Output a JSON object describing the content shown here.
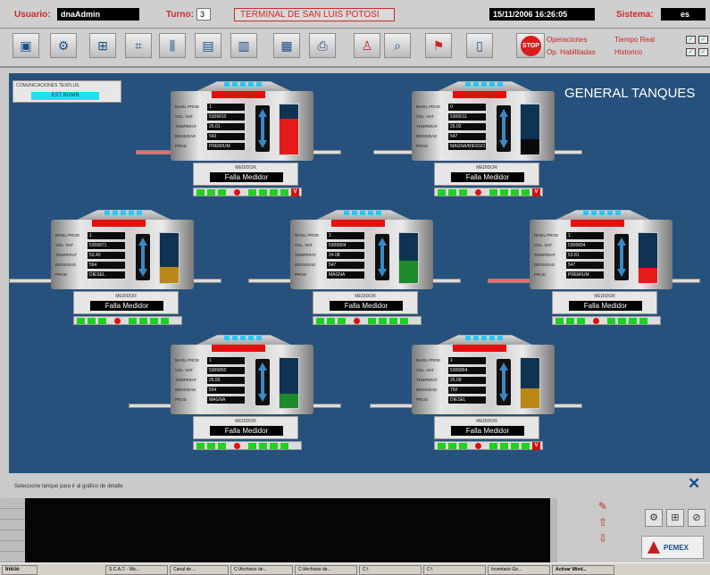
{
  "header": {
    "usuario_label": "Usuario:",
    "usuario_value": "dnaAdmin",
    "turno_label": "Turno:",
    "turno_value": "3",
    "terminal": "TERMINAL DE  SAN LUIS POTOSI",
    "datetime": "15/11/2006  16:26:05",
    "sistema_label": "Sistema:",
    "sistema_value": "es"
  },
  "toolbar": {
    "buttons": [
      "tv-icon",
      "pump-icon",
      "valve-icon",
      "chart-icon",
      "tank-icon",
      "screen-icon",
      "monitor-icon",
      "folder-icon",
      "printer-icon",
      "person-icon",
      "search-icon",
      "antenna-icon",
      "document-icon"
    ],
    "stop_label": "STOP",
    "operaciones": "Operaciones",
    "op_habilitadas": "Op. Habilitadas",
    "tiempo_real": "Tiempo Real",
    "historico": "Historico"
  },
  "main": {
    "comm_title": "COMUNICACIONES TEXPLUS",
    "comm_value": "EST BOMB",
    "title": "GENERAL TANQUES",
    "row_labels": [
      "NIVEL PROD",
      "VOL. NAT",
      "TEMPERAT",
      "DENSIDAD",
      "PROD"
    ],
    "medidor_title": "MEDIDOR",
    "tanks": [
      {
        "values": [
          "1",
          "5306810",
          "25.01",
          "543",
          "PREMIUM"
        ],
        "medidor": "Falla Medidor",
        "level": 0.72,
        "fill_color": "#e41b1b",
        "v_flag": true
      },
      {
        "values": [
          "0",
          "5306011",
          "25.02",
          "547",
          "MAGNA/RIESGO"
        ],
        "medidor": "Falla Medidor",
        "level": 0.3,
        "fill_color": "#0a0a0a",
        "v_flag": true
      },
      {
        "values": [
          "1",
          "5306871",
          "53.40",
          "564",
          "DIESEL"
        ],
        "medidor": "Falla Medidor",
        "level": 0.32,
        "fill_color": "#b98716",
        "v_flag": false
      },
      {
        "values": [
          "1",
          "5306804",
          "24.08",
          "547",
          "MAGNA"
        ],
        "medidor": "Falla Medidor",
        "level": 0.45,
        "fill_color": "#1d8a2c",
        "v_flag": false
      },
      {
        "values": [
          "1",
          "5306804",
          "53.81",
          "547",
          "PREMIUM"
        ],
        "medidor": "Falla Medidor",
        "level": 0.3,
        "fill_color": "#e41b1b",
        "v_flag": false
      },
      {
        "values": [
          "1",
          "5306850",
          "25.55",
          "554",
          "MAGNA"
        ],
        "medidor": "Falla Medidor",
        "level": 0.28,
        "fill_color": "#1d8a2c",
        "v_flag": false
      },
      {
        "values": [
          "1",
          "5306864",
          "25.09",
          "750",
          "DIESEL"
        ],
        "medidor": "Falla Medidor",
        "level": 0.4,
        "fill_color": "#b98716",
        "v_flag": true
      }
    ]
  },
  "status": {
    "message": "Seleccione tanque para ir al gráfico de detalle"
  },
  "pemex_label": "PEMEX",
  "taskbar": {
    "items": [
      "Inicio",
      "S.C.A.T. - Mic...",
      "Canal de ...",
      "C:\\Archivos de...",
      "C:\\Archivos de...",
      "C:\\",
      "C:\\",
      "Inventario Ge...",
      "Activar Wind..."
    ]
  }
}
